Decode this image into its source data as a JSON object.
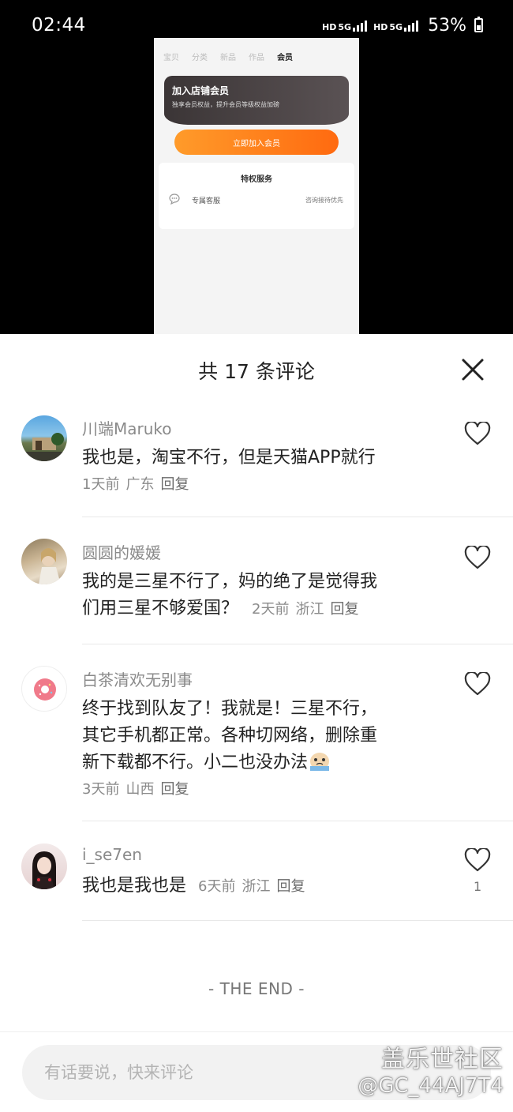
{
  "status_bar": {
    "time": "02:44",
    "net1_type": "HD",
    "net1_gen": "5G",
    "net2_type": "HD",
    "net2_gen": "5G",
    "battery": "53%"
  },
  "preview": {
    "tabs": [
      "宝贝",
      "分类",
      "新品",
      "作品",
      "会员"
    ],
    "active_tab": 4,
    "card_title": "加入店铺会员",
    "card_subtitle": "独享会员权益，提升会员等级权益加磅",
    "join_button": "立即加入会员",
    "privilege_title": "特权服务",
    "privilege_item": "专属客服",
    "privilege_desc": "咨询接待优先"
  },
  "sheet": {
    "title": "共 17 条评论",
    "comments": [
      {
        "name": "川端Maruko",
        "lines": [
          "我也是，淘宝不行，但是天猫APP就行"
        ],
        "time": "1天前",
        "location": "广东",
        "reply": "回复",
        "likes": ""
      },
      {
        "name": "圆圆的媛媛",
        "lines": [
          "我的是三星不行了，妈的绝了是觉得我",
          "们用三星不够爱国？"
        ],
        "time": "2天前",
        "location": "浙江",
        "reply": "回复",
        "likes": ""
      },
      {
        "name": "白茶清欢无别事",
        "lines": [
          "终于找到队友了！我就是！三星不行，",
          "其它手机都正常。各种切网络，删除重",
          "新下载都不行。小二也没办法"
        ],
        "time": "3天前",
        "location": "山西",
        "reply": "回复",
        "likes": ""
      },
      {
        "name": "i_se7en",
        "lines": [
          "我也是我也是"
        ],
        "time": "6天前",
        "location": "浙江",
        "reply": "回复",
        "likes": "1"
      }
    ],
    "end_text": "- THE END -",
    "input_placeholder": "有话要说，快来评论"
  },
  "watermark": {
    "line1": "盖乐世社区",
    "line2": "@GC_44AJ7T4"
  },
  "colors": {
    "join_button_start": "#ff9b2a",
    "join_button_end": "#ff6a10",
    "card_dark": "#3b3536"
  }
}
